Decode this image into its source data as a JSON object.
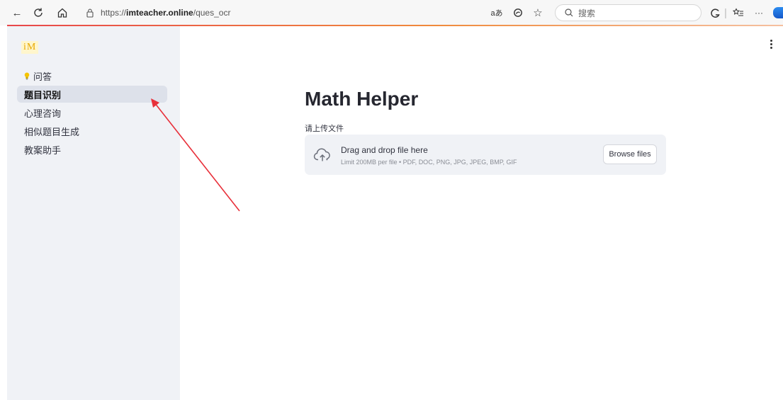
{
  "browser": {
    "url_prefix": "https://",
    "url_domain": "imteacher.online",
    "url_path": "/ques_ocr",
    "search_placeholder": "搜索",
    "read_aloud": "aあ",
    "more": "···"
  },
  "sidebar": {
    "logo": "iM",
    "items": [
      {
        "label": "问答",
        "icon": "lightbulb-icon"
      },
      {
        "label": "题目识别"
      },
      {
        "label": "心理咨询"
      },
      {
        "label": "相似题目生成"
      },
      {
        "label": "教案助手"
      }
    ],
    "active_index": 1
  },
  "main": {
    "title": "Math Helper",
    "upload_label": "请上传文件",
    "dropzone": {
      "title": "Drag and drop file here",
      "limit": "Limit 200MB per file • PDF, DOC, PNG, JPG, JPEG, BMP, GIF",
      "browse_label": "Browse files"
    }
  },
  "colors": {
    "sidebar_bg": "#f0f2f6",
    "annotation_arrow": "#e8303a",
    "logo": "#e8a800"
  }
}
